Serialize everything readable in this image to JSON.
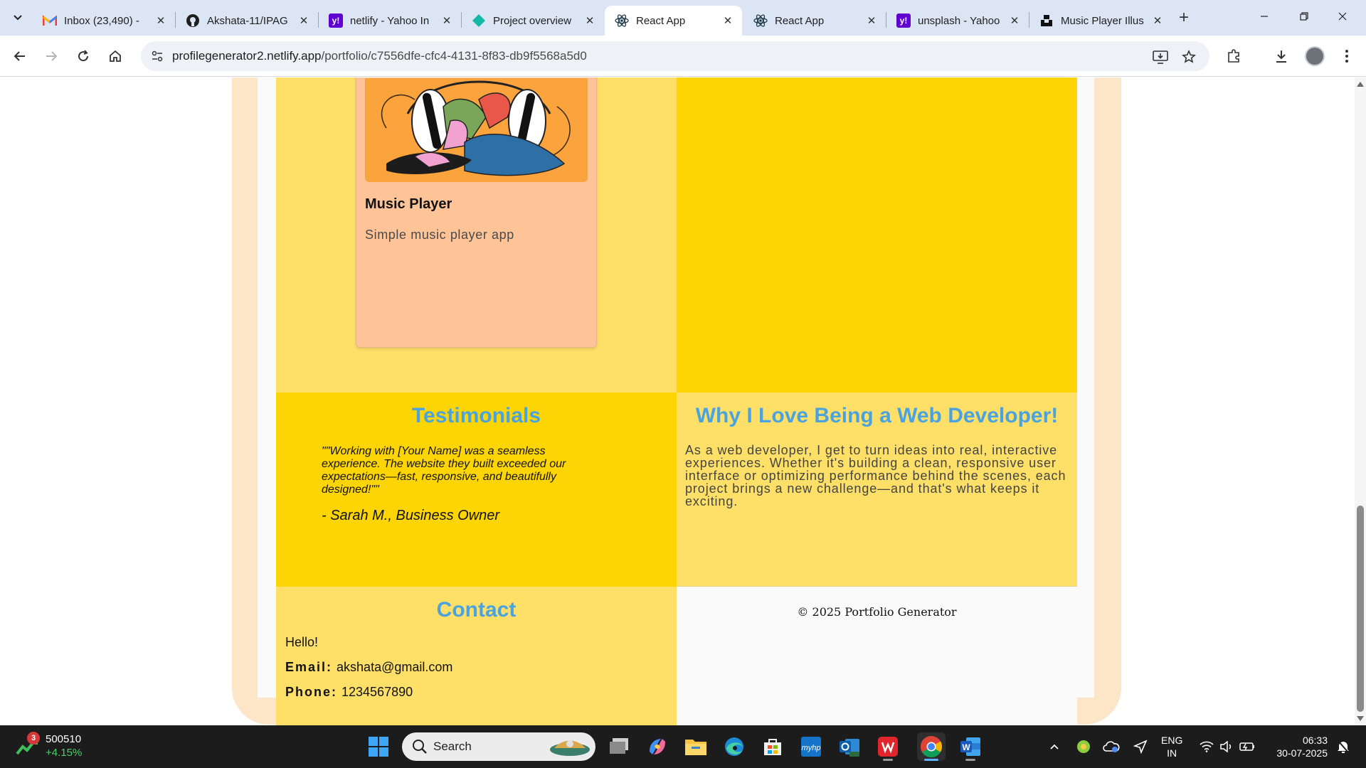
{
  "browser": {
    "tabs": [
      {
        "title": "Inbox (23,490) -",
        "icon": "gmail-icon",
        "active": false
      },
      {
        "title": "Akshata-11/IPAG",
        "icon": "github-icon",
        "active": false
      },
      {
        "title": "netlify - Yahoo In",
        "icon": "yahoo-icon",
        "active": false
      },
      {
        "title": "Project overview",
        "icon": "diamond-icon",
        "active": false
      },
      {
        "title": "React App",
        "icon": "react-icon",
        "active": true
      },
      {
        "title": "React App",
        "icon": "react-icon",
        "active": false
      },
      {
        "title": "unsplash - Yahoo",
        "icon": "yahoo-icon",
        "active": false
      },
      {
        "title": "Music Player Illus",
        "icon": "unsplash-icon",
        "active": false
      }
    ],
    "url_host": "profilegenerator2.netlify.app",
    "url_path": "/portfolio/c7556dfe-cfc4-4131-8f83-db9f5568a5d0"
  },
  "page": {
    "project": {
      "title": "Music Player",
      "description": "Simple music player app"
    },
    "testimonials": {
      "title": "Testimonials",
      "quote": "\"\"Working with [Your Name] was a seamless experience. The website they built exceeded our expectations—fast, responsive, and beautifully designed!\"\"",
      "author": "- Sarah M., Business Owner"
    },
    "why": {
      "title": "Why I Love Being a Web Developer!",
      "text": "As a web developer, I get to turn ideas into real, interactive experiences. Whether it's building a clean, responsive user interface or optimizing performance behind the scenes, each project brings a new challenge—and that's what keeps it exciting."
    },
    "contact": {
      "title": "Contact",
      "greeting": "Hello!",
      "email_label": "Email:",
      "email": "akshata@gmail.com",
      "phone_label": "Phone:",
      "phone": "1234567890"
    },
    "footer": "© 2025 Portfolio Generator"
  },
  "colors": {
    "heading": "#4aa3df",
    "light_yellow": "#fee068",
    "gold": "#fdd504",
    "card": "#fec498",
    "frame": "#fde5c7"
  },
  "taskbar": {
    "stock_badge": "3",
    "stock_value": "500510",
    "stock_change": "+4.15%",
    "search_label": "Search",
    "lang_1": "ENG",
    "lang_2": "IN",
    "time": "06:33",
    "date": "30-07-2025"
  }
}
